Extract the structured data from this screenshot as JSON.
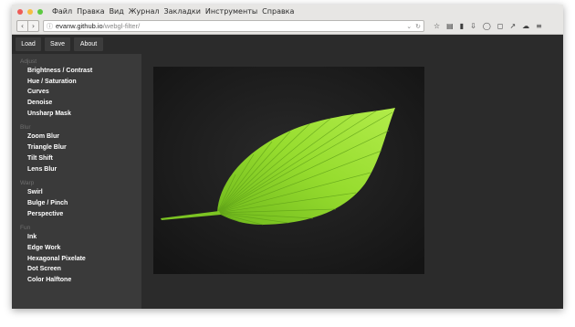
{
  "browser": {
    "menu": [
      "Файл",
      "Правка",
      "Вид",
      "Журнал",
      "Закладки",
      "Инструменты",
      "Справка"
    ],
    "url_host": "evanw.github.io",
    "url_path": "/webgl-filter/"
  },
  "app": {
    "toolbar": {
      "load": "Load",
      "save": "Save",
      "about": "About"
    },
    "sidebar": [
      {
        "category": "Adjust",
        "filters": [
          "Brightness / Contrast",
          "Hue / Saturation",
          "Curves",
          "Denoise",
          "Unsharp Mask"
        ]
      },
      {
        "category": "Blur",
        "filters": [
          "Zoom Blur",
          "Triangle Blur",
          "Tilt Shift",
          "Lens Blur"
        ]
      },
      {
        "category": "Warp",
        "filters": [
          "Swirl",
          "Bulge / Pinch",
          "Perspective"
        ]
      },
      {
        "category": "Fun",
        "filters": [
          "Ink",
          "Edge Work",
          "Hexagonal Pixelate",
          "Dot Screen",
          "Color Halftone"
        ]
      }
    ]
  },
  "colors": {
    "traffic_close": "#ee5b56",
    "traffic_min": "#f6bd42",
    "traffic_max": "#5cc940",
    "leaf": "#8fd629"
  }
}
